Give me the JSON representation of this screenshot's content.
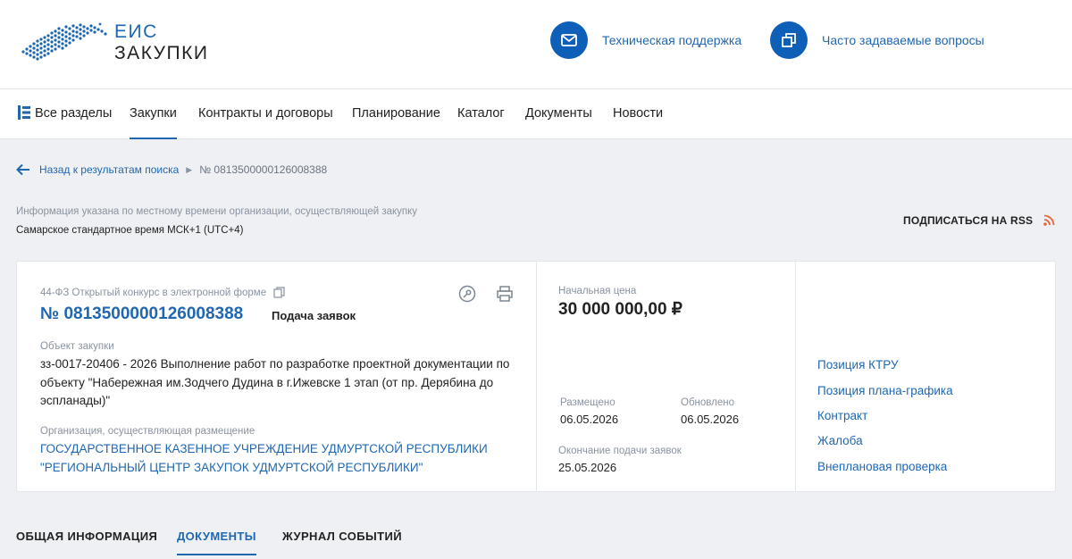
{
  "header": {
    "logo_line1": "ЕИС",
    "logo_line2": "ЗАКУПКИ",
    "support_label": "Техническая поддержка",
    "faq_label": "Часто задаваемые вопросы",
    "accent_color": "#0d5fb8"
  },
  "nav": {
    "items": [
      {
        "label": "Все разделы",
        "icon": "sections-icon"
      },
      {
        "label": "Закупки",
        "active": true
      },
      {
        "label": "Контракты и договоры"
      },
      {
        "label": "Планирование"
      },
      {
        "label": "Каталог"
      },
      {
        "label": "Документы"
      },
      {
        "label": "Новости"
      }
    ]
  },
  "breadcrumb": {
    "back_label": "Назад к результатам поиска",
    "current": "№ 0813500000126008388"
  },
  "timezone": {
    "note": "Информация указана по местному времени организации, осуществляющей закупку",
    "value": "Самарское стандартное время МСК+1 (UTC+4)"
  },
  "rss": {
    "label": "ПОДПИСАТЬСЯ НА RSS"
  },
  "card": {
    "procedure_type": "44-ФЗ Открытый конкурс в электронной форме",
    "number": "№ 0813500000126008388",
    "status": "Подача заявок",
    "object_label": "Объект закупки",
    "object_text": "зз-0017-20406 - 2026 Выполнение работ по разработке проектной документации по объекту \"Набережная им.Зодчего Дудина в г.Ижевске 1 этап (от пр. Дерябина до эспланады)\"",
    "org_label": "Организация, осуществляющая размещение",
    "org_text": "ГОСУДАРСТВЕННОЕ КАЗЕННОЕ УЧРЕЖДЕНИЕ УДМУРТСКОЙ РЕСПУБЛИКИ \"РЕГИОНАЛЬНЫЙ ЦЕНТР ЗАКУПОК УДМУРТСКОЙ РЕСПУБЛИКИ\"",
    "price_label": "Начальная цена",
    "price": "30 000 000,00 ₽",
    "posted_label": "Размещено",
    "posted": "06.05.2026",
    "updated_label": "Обновлено",
    "updated": "06.05.2026",
    "deadline_label": "Окончание подачи заявок",
    "deadline": "25.05.2026",
    "links": [
      "Позиция КТРУ",
      "Позиция плана-графика",
      "Контракт",
      "Жалоба",
      "Внеплановая проверка"
    ]
  },
  "tabs": [
    {
      "label": "ОБЩАЯ ИНФОРМАЦИЯ"
    },
    {
      "label": "ДОКУМЕНТЫ",
      "active": true
    },
    {
      "label": "ЖУРНАЛ СОБЫТИЙ"
    }
  ]
}
